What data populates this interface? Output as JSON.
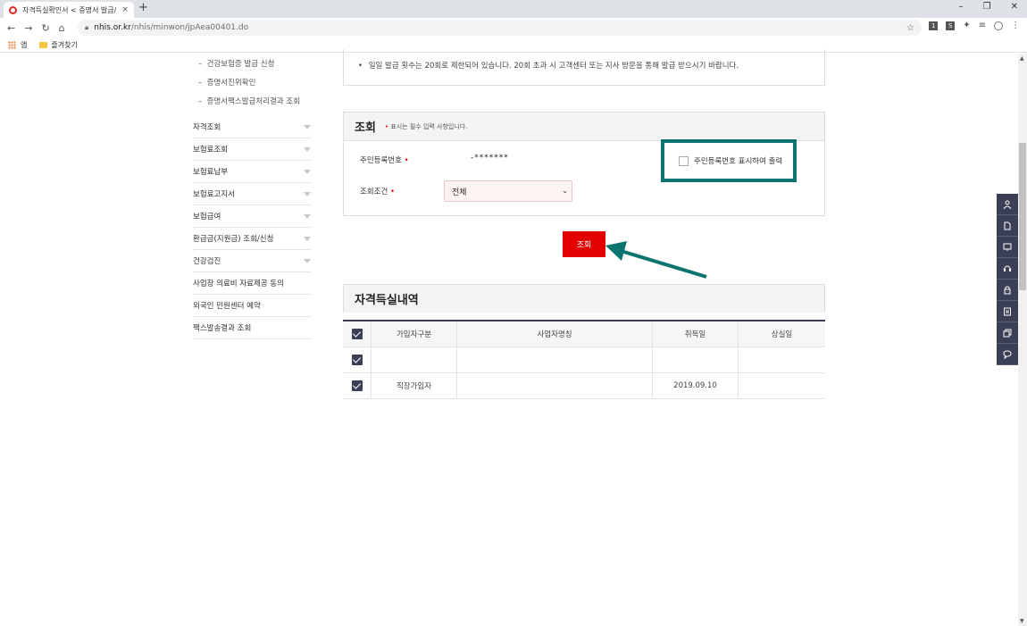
{
  "browser": {
    "tab_title": "자격득실확인서 < 증명서 발급/",
    "tab_close": "×",
    "new_tab": "+",
    "url_host": "nhis.or.kr",
    "url_path": "/nhis/minwon/jpAea00401.do",
    "bookmark_apps": "앱",
    "bookmark_folder": "즐겨찾기",
    "window_controls": [
      "–",
      "❐",
      "✕"
    ]
  },
  "sidebar": {
    "subitems": [
      "건강보험증 발급 신청",
      "증명서진위확인",
      "증명서팩스발급처리결과 조회"
    ],
    "items": [
      {
        "label": "자격조회",
        "has_sub": true
      },
      {
        "label": "보험료조회",
        "has_sub": true
      },
      {
        "label": "보험료납부",
        "has_sub": true
      },
      {
        "label": "보험료고지서",
        "has_sub": true
      },
      {
        "label": "보험급여",
        "has_sub": true
      },
      {
        "label": "환급금(지원금) 조회/신청",
        "has_sub": true
      },
      {
        "label": "건강검진",
        "has_sub": true
      },
      {
        "label": "사업장 의료비 자료제공 동의",
        "has_sub": false
      },
      {
        "label": "외국인 민원센터 예약",
        "has_sub": false
      },
      {
        "label": "팩스발송결과 조회",
        "has_sub": false
      }
    ]
  },
  "notice": {
    "bullet": "•",
    "text": "일일 발급 횟수는 20회로 제한되어 있습니다. 20회 초과 시 고객센터 또는 지사 방문을 통해 발급 받으시기 바랍니다."
  },
  "query": {
    "title": "조회",
    "required_note": "표시는 필수 입력 사항입니다.",
    "required_mark": "•",
    "resident_label": "주민등록번호",
    "resident_value": "-*******",
    "condition_label": "조회조건",
    "condition_value": "전체",
    "show_resident_label": "주민등록번호 표시하여 출력",
    "search_button": "조회"
  },
  "result": {
    "title": "자격득실내역",
    "columns": [
      "가입자구분",
      "사업자명칭",
      "취득일",
      "상실일"
    ],
    "rows": [
      {
        "type": "",
        "company": "",
        "acquired": "",
        "lost": ""
      },
      {
        "type": "직장가입자",
        "company": "",
        "acquired": "2019.09.10",
        "lost": ""
      }
    ]
  },
  "quick_menu": [
    "person-icon",
    "document-icon",
    "monitor-icon",
    "headset-icon",
    "lock-icon",
    "list-icon",
    "copy-icon",
    "chat-icon"
  ],
  "colors": {
    "accent_red": "#e30000",
    "highlight_teal": "#0b7470",
    "navy": "#3b3f56"
  }
}
